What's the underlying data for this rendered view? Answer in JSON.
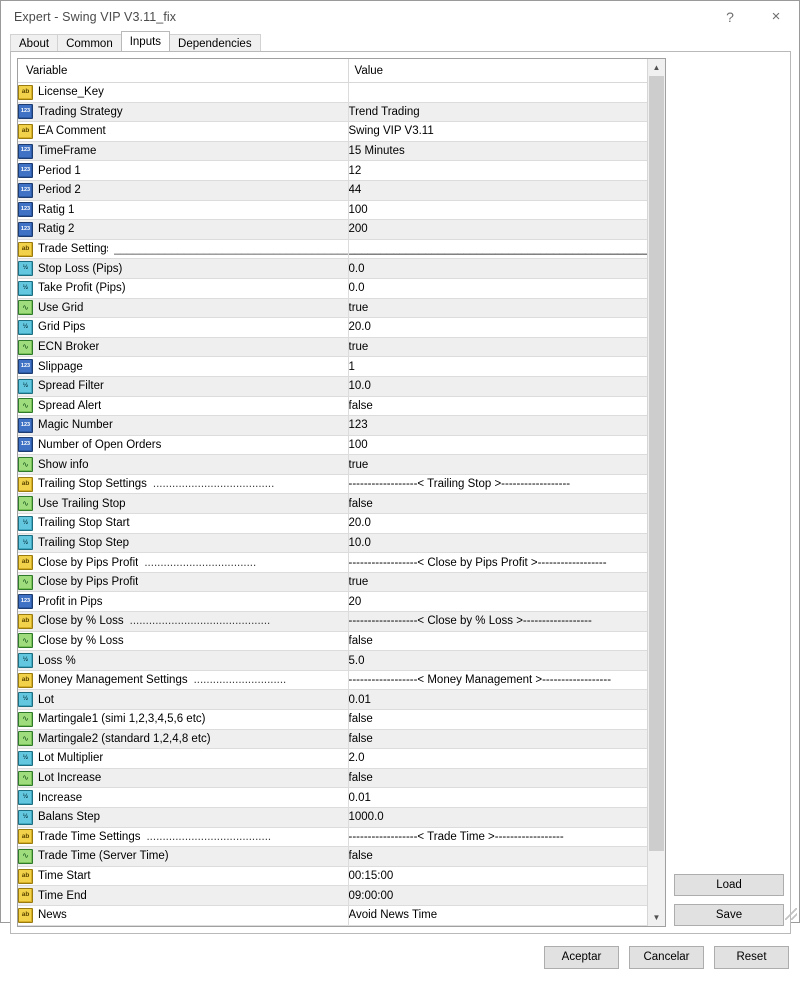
{
  "window": {
    "title": "Expert - Swing VIP V3.11_fix",
    "help_glyph": "?",
    "close_glyph": "×"
  },
  "tabs": [
    {
      "label": "About",
      "active": false
    },
    {
      "label": "Common",
      "active": false
    },
    {
      "label": "Inputs",
      "active": true
    },
    {
      "label": "Dependencies",
      "active": false
    }
  ],
  "grid": {
    "columns": [
      "Variable",
      "Value"
    ],
    "rows": [
      {
        "icon": "string-icon",
        "type": "string",
        "variable": "License_Key",
        "value": ""
      },
      {
        "icon": "int-icon",
        "type": "int",
        "variable": "Trading Strategy",
        "value": "Trend Trading"
      },
      {
        "icon": "string-icon",
        "type": "string",
        "variable": "EA Comment",
        "value": "Swing VIP V3.11"
      },
      {
        "icon": "int-icon",
        "type": "int",
        "variable": "TimeFrame",
        "value": "15 Minutes"
      },
      {
        "icon": "int-icon",
        "type": "int",
        "variable": "Period 1",
        "value": "12"
      },
      {
        "icon": "int-icon",
        "type": "int",
        "variable": "Period 2",
        "value": "44"
      },
      {
        "icon": "int-icon",
        "type": "int",
        "variable": "Ratig 1",
        "value": "100"
      },
      {
        "icon": "int-icon",
        "type": "int",
        "variable": "Ratig 2",
        "value": "200"
      },
      {
        "icon": "string-icon",
        "type": "string",
        "variable": "Trade Settings",
        "separator": "solid",
        "dots": "_______________________________________",
        "value": "______________________________________________________________"
      },
      {
        "icon": "double-icon",
        "type": "double",
        "variable": "Stop Loss (Pips)",
        "value": "0.0"
      },
      {
        "icon": "double-icon",
        "type": "double",
        "variable": "Take Profit (Pips)",
        "value": "0.0"
      },
      {
        "icon": "bool-icon",
        "type": "bool",
        "variable": "Use Grid",
        "value": "true"
      },
      {
        "icon": "double-icon",
        "type": "double",
        "variable": "Grid Pips",
        "value": "20.0"
      },
      {
        "icon": "bool-icon",
        "type": "bool",
        "variable": "ECN Broker",
        "value": "true"
      },
      {
        "icon": "int-icon",
        "type": "int",
        "variable": "Slippage",
        "value": "1"
      },
      {
        "icon": "double-icon",
        "type": "double",
        "variable": "Spread Filter",
        "value": "10.0"
      },
      {
        "icon": "bool-icon",
        "type": "bool",
        "variable": "Spread Alert",
        "value": "false"
      },
      {
        "icon": "int-icon",
        "type": "int",
        "variable": "Magic Number",
        "value": "123"
      },
      {
        "icon": "int-icon",
        "type": "int",
        "variable": "Number of Open Orders",
        "value": "100"
      },
      {
        "icon": "bool-icon",
        "type": "bool",
        "variable": "Show info",
        "value": "true"
      },
      {
        "icon": "string-icon",
        "type": "string",
        "variable": "Trailing Stop Settings",
        "separator": "dotted",
        "dots": "......................................",
        "value": "------------------< Trailing Stop >------------------"
      },
      {
        "icon": "bool-icon",
        "type": "bool",
        "variable": "Use Trailing Stop",
        "value": "false"
      },
      {
        "icon": "double-icon",
        "type": "double",
        "variable": "Trailing Stop Start",
        "value": "20.0"
      },
      {
        "icon": "double-icon",
        "type": "double",
        "variable": "Trailing Stop Step",
        "value": "10.0"
      },
      {
        "icon": "string-icon",
        "type": "string",
        "variable": "Close by Pips Profit",
        "separator": "dotted",
        "dots": "...................................",
        "value": "------------------< Close by Pips Profit >------------------"
      },
      {
        "icon": "bool-icon",
        "type": "bool",
        "variable": "Close by Pips Profit",
        "value": "true"
      },
      {
        "icon": "int-icon",
        "type": "int",
        "variable": "Profit in Pips",
        "value": "20"
      },
      {
        "icon": "string-icon",
        "type": "string",
        "variable": "Close by % Loss",
        "separator": "dotted",
        "dots": "............................................",
        "value": "------------------< Close by % Loss >------------------"
      },
      {
        "icon": "bool-icon",
        "type": "bool",
        "variable": "Close by % Loss",
        "value": "false"
      },
      {
        "icon": "double-icon",
        "type": "double",
        "variable": "Loss %",
        "value": "5.0"
      },
      {
        "icon": "string-icon",
        "type": "string",
        "variable": "Money Management Settings",
        "separator": "dotted",
        "dots": ".............................",
        "value": "------------------< Money Management >------------------"
      },
      {
        "icon": "double-icon",
        "type": "double",
        "variable": "Lot",
        "value": "0.01"
      },
      {
        "icon": "bool-icon",
        "type": "bool",
        "variable": "Martingale1 (simi 1,2,3,4,5,6 etc)",
        "value": "false"
      },
      {
        "icon": "bool-icon",
        "type": "bool",
        "variable": "Martingale2 (standard 1,2,4,8 etc)",
        "value": "false"
      },
      {
        "icon": "double-icon",
        "type": "double",
        "variable": "Lot Multiplier",
        "value": "2.0"
      },
      {
        "icon": "bool-icon",
        "type": "bool",
        "variable": "Lot Increase",
        "value": "false"
      },
      {
        "icon": "double-icon",
        "type": "double",
        "variable": "Increase",
        "value": "0.01"
      },
      {
        "icon": "double-icon",
        "type": "double",
        "variable": "Balans Step",
        "value": "1000.0"
      },
      {
        "icon": "string-icon",
        "type": "string",
        "variable": "Trade Time Settings",
        "separator": "dotted",
        "dots": ".......................................",
        "value": "------------------< Trade Time >------------------"
      },
      {
        "icon": "bool-icon",
        "type": "bool",
        "variable": "Trade Time (Server Time)",
        "value": "false"
      },
      {
        "icon": "string-icon",
        "type": "string",
        "variable": "Time Start",
        "value": "00:15:00"
      },
      {
        "icon": "string-icon",
        "type": "string",
        "variable": "Time End",
        "value": "09:00:00"
      },
      {
        "icon": "string-icon",
        "type": "string",
        "variable": "News",
        "value": "Avoid News Time"
      }
    ]
  },
  "scrollbar": {
    "up_glyph": "▲",
    "down_glyph": "▼"
  },
  "side_buttons": [
    {
      "label": "Load"
    },
    {
      "label": "Save"
    }
  ],
  "bottom_buttons": [
    {
      "label": "Aceptar"
    },
    {
      "label": "Cancelar"
    },
    {
      "label": "Reset"
    }
  ],
  "icons": {
    "string-icon": "ab",
    "int-icon": "123",
    "double-icon": "½",
    "bool-icon": "∿"
  },
  "colors": {
    "string": "#f2d24a",
    "int": "#3f72c4",
    "double": "#63c8df",
    "bool": "#9fdc7d",
    "row_alt": "#efefef",
    "dialog_bg": "#ffffff"
  }
}
